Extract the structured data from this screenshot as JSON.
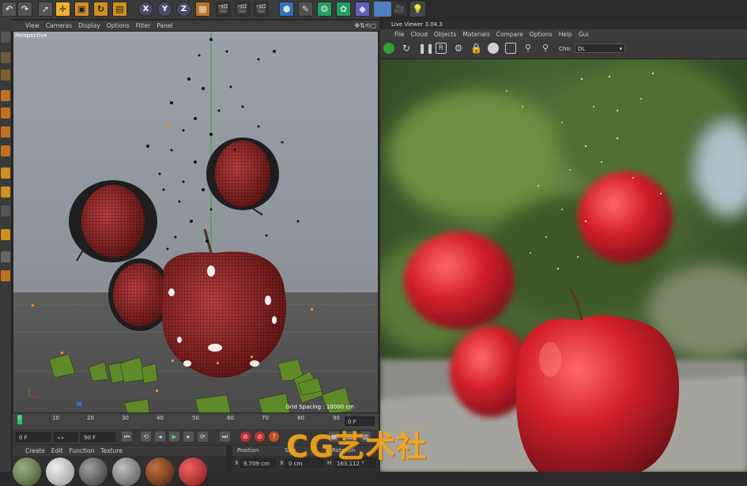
{
  "viewport": {
    "menu": [
      "View",
      "Cameras",
      "Display",
      "Options",
      "Filter",
      "Panel"
    ],
    "label": "Perspective",
    "grid_spacing": "Grid Spacing : 10000 cm"
  },
  "timeline": {
    "ticks": [
      "0",
      "10",
      "20",
      "30",
      "40",
      "50",
      "60",
      "70",
      "80",
      "90"
    ],
    "current_frame_field": "0 F",
    "end_frame_field": "90 F",
    "total_frames_display": "0 F"
  },
  "material_manager": {
    "menu": [
      "Create",
      "Edit",
      "Function",
      "Texture"
    ]
  },
  "coordinates": {
    "headers": [
      "Position",
      "Size",
      "Rotation"
    ],
    "x_position": "9.709 cm",
    "x_size": "0 cm",
    "h_rotation": "163.112 °",
    "x_label": "X",
    "x2_label": "X",
    "h_label": "H"
  },
  "live_viewer": {
    "title": "Live Viewer 3.04.3",
    "menu": [
      "File",
      "Cloud",
      "Objects",
      "Materials",
      "Compare",
      "Options",
      "Help",
      "Gui"
    ],
    "channel_label": "Chn:",
    "channel_value": "DL"
  },
  "top_toolbar": {
    "axis_x": "X",
    "axis_y": "Y",
    "axis_z": "Z"
  },
  "watermark": "CG艺术社",
  "colors": {
    "accent_orange": "#f0b030",
    "apple_red": "#c8202a",
    "watermark": "#f5a81e"
  }
}
